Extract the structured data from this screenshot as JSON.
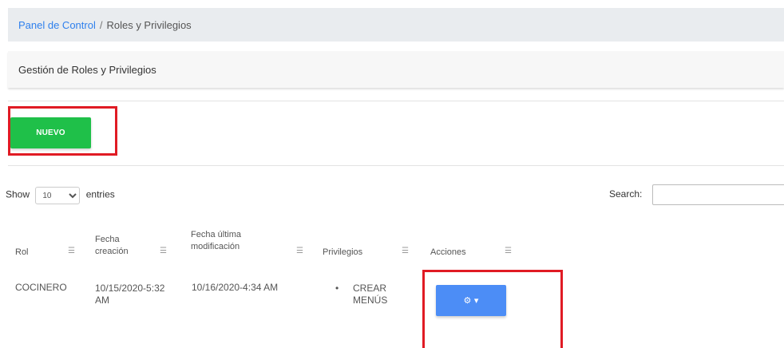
{
  "breadcrumb": {
    "home": "Panel de Control",
    "separator": "/",
    "current": "Roles y Privilegios"
  },
  "card": {
    "title": "Gestión de Roles y Privilegios"
  },
  "buttons": {
    "new_label": "NUEVO",
    "actions_icons": "⚙︎ ▾"
  },
  "length_control": {
    "prefix": "Show",
    "selected": "10",
    "suffix": "entries"
  },
  "search": {
    "label": "Search:",
    "value": ""
  },
  "table": {
    "sort_icon": "☰",
    "headers": {
      "rol": "Rol",
      "fecha_creacion_1": "Fecha",
      "fecha_creacion_2": "creación",
      "fecha_mod_1": "Fecha última",
      "fecha_mod_2": "modificación",
      "privilegios": "Privilegios",
      "acciones": "Acciones"
    },
    "rows": [
      {
        "rol": "COCINERO",
        "fecha_creacion_1": "10/15/2020-5:32",
        "fecha_creacion_2": "AM",
        "fecha_mod": "10/16/2020-4:34 AM",
        "privilegio_1": "CREAR",
        "privilegio_2": "MENÚS",
        "bullet": "•"
      }
    ]
  },
  "colors": {
    "primary": "#2f80ed",
    "success": "#1fc049",
    "action": "#4c8df6",
    "highlight": "#e01b24"
  }
}
